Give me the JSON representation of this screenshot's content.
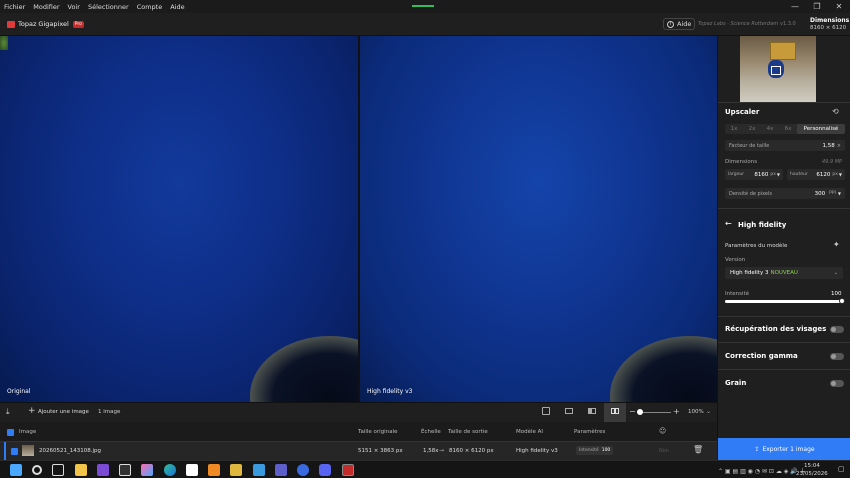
{
  "menu": [
    "Fichier",
    "Modifier",
    "Voir",
    "Sélectionner",
    "Compte",
    "Aide"
  ],
  "window_controls": {
    "minimize": "—",
    "maximize": "❐",
    "close": "✕"
  },
  "header": {
    "app_name": "Topaz Gigapixel",
    "badge": "Pro",
    "help_label": "Aide",
    "user_text": "Topaz Labs · Science Rotterdam",
    "version": "v1.3.0",
    "dims_title": "Dimensions",
    "dims_value": "8160 × 6120"
  },
  "viewer": {
    "left_label": "Original",
    "right_label": "High fidelity v3"
  },
  "sidebar": {
    "upscaler_title": "Upscaler",
    "scales": [
      "1x",
      "2x",
      "4x",
      "6x",
      "Personnalisé"
    ],
    "scale_factor_label": "Facteur de taille",
    "scale_factor_value": "1,58",
    "scale_factor_unit": "×",
    "dimensions_label": "Dimensions",
    "dimensions_mp": "49,9 MP",
    "width_label": "largeur",
    "width_value": "8160",
    "width_unit": "px",
    "height_label": "hauteur",
    "height_value": "6120",
    "height_unit": "px",
    "density_label": "Densité de pixels",
    "density_value": "300",
    "density_unit": "PPI",
    "model_title": "High fidelity",
    "params_label": "Paramètres du modèle",
    "version_label": "Version",
    "version_value": "High fidelity 3",
    "version_new": "NOUVEAU",
    "intensity_label": "Intensité",
    "intensity_value": "100",
    "intensity_fraction": 1.0,
    "face_recovery": "Récupération des visages",
    "gamma": "Correction gamma",
    "grain": "Grain",
    "export_label": "Exporter 1 image"
  },
  "toolbar": {
    "add_image": "Ajouter une image",
    "count": "1 image",
    "zoom": "100%"
  },
  "table": {
    "headers": [
      "Image",
      "Taille originale",
      "Échelle",
      "Taille de sortie",
      "Modèle AI",
      "Paramètres"
    ],
    "row": {
      "filename": "20260521_143108.jpg",
      "orig_size": "5151 × 3863 px",
      "scale": "1,58x",
      "arrow": "→",
      "out_size": "8160 × 6120 px",
      "model": "High fidelity v3",
      "param_label": "Intensité",
      "param_value": "100",
      "extra": "Non"
    }
  },
  "taskbar": {
    "time": "15:04",
    "date": "23/05/2026"
  },
  "colors": {
    "accent": "#2f7cf6",
    "new_badge": "#8fd14f",
    "brand": "#e03a3a"
  }
}
